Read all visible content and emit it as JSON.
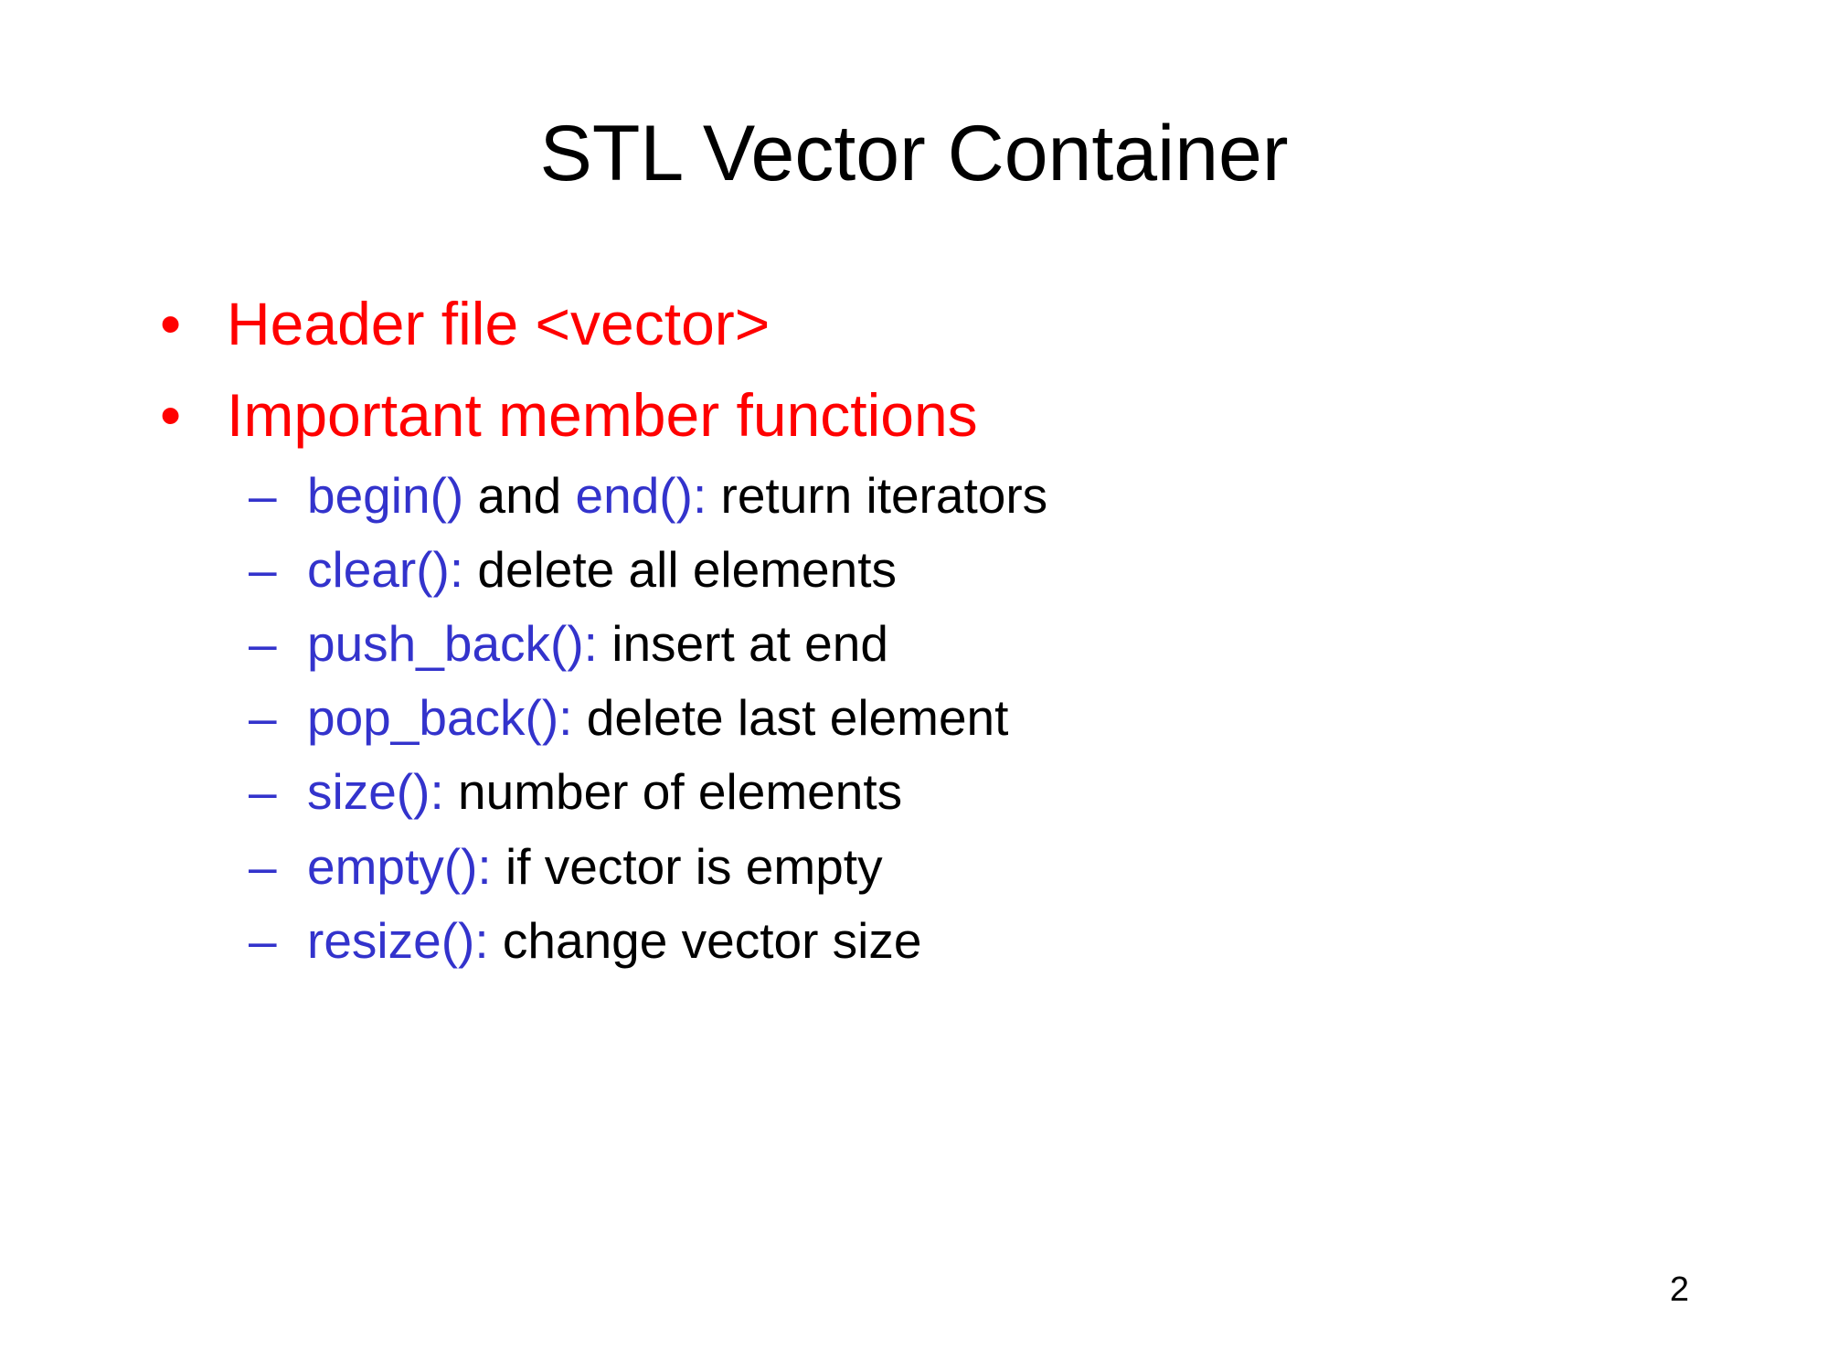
{
  "slide": {
    "title": "STL Vector Container",
    "page_number": "2",
    "colors": {
      "heading_bullets": "#ff0000",
      "function_names": "#3333cc",
      "body_text": "#000000",
      "background": "#ffffff"
    },
    "bullets": [
      {
        "marker": "•",
        "text": "Header file <vector>"
      },
      {
        "marker": "•",
        "text": "Important member functions"
      }
    ],
    "sub_bullets": [
      {
        "marker": "–",
        "fn1": "begin()",
        "mid": " and ",
        "fn2": "end():",
        "desc": " return iterators"
      },
      {
        "marker": "–",
        "fn": "clear():",
        "desc": " delete all elements"
      },
      {
        "marker": "–",
        "fn": "push_back():",
        "desc": " insert at end"
      },
      {
        "marker": "–",
        "fn": "pop_back():",
        "desc": " delete last element"
      },
      {
        "marker": "–",
        "fn": "size():",
        "desc": " number of elements"
      },
      {
        "marker": "–",
        "fn": "empty():",
        "desc": " if vector is empty"
      },
      {
        "marker": "–",
        "fn": "resize():",
        "desc": " change vector size"
      }
    ]
  }
}
